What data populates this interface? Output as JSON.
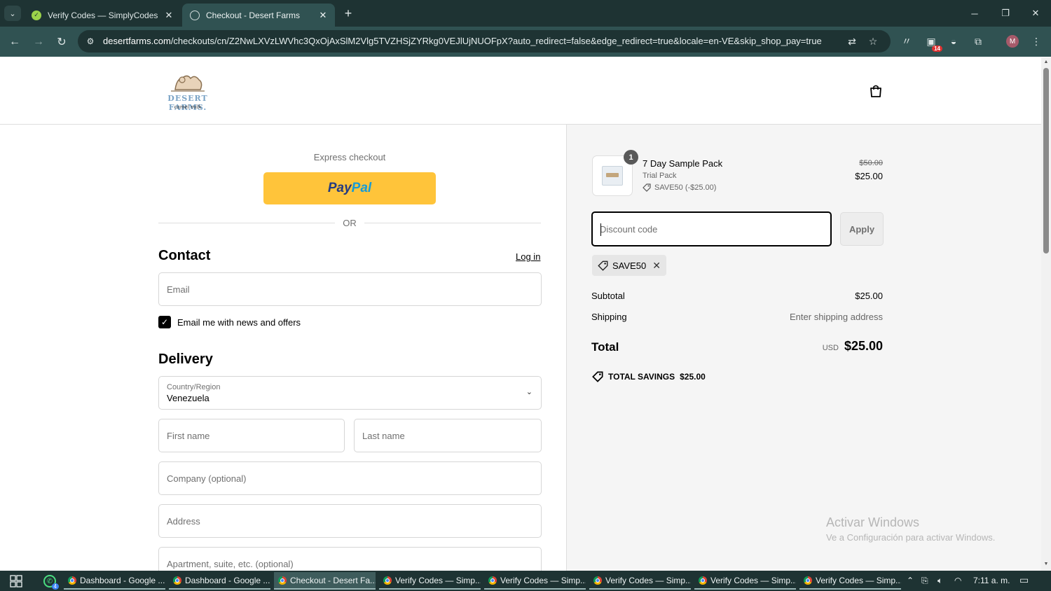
{
  "browser": {
    "tabs": [
      {
        "title": "Verify Codes — SimplyCodes",
        "active": false
      },
      {
        "title": "Checkout - Desert Farms",
        "active": true
      }
    ],
    "url_host": "desertfarms.com",
    "url_path": "/checkouts/cn/Z2NwLXVzLWVhc3QxOjAxSlM2Vlg5TVZHSjZYRkg0VEJlUjNUOFpX?auto_redirect=false&edge_redirect=true&locale=en-VE&skip_shop_pay=true",
    "extension_badge": "14",
    "profile_initial": "M",
    "icons": {
      "tab_search": "chevron-down-icon",
      "new_tab": "plus-icon",
      "back": "arrow-left-icon",
      "forward": "arrow-right-icon",
      "reload": "reload-icon",
      "site_info": "tune-icon",
      "translate": "translate-icon",
      "bookmark": "star-icon"
    }
  },
  "store": {
    "logo_text": "DESERT FARMS.",
    "logo_subtext": "camel milk"
  },
  "express": {
    "label": "Express checkout",
    "paypal_part1": "Pay",
    "paypal_part2": "Pal",
    "or_text": "OR"
  },
  "contact": {
    "title": "Contact",
    "login_link": "Log in",
    "email_placeholder": "Email",
    "newsletter_label": "Email me with news and offers",
    "newsletter_checked": true
  },
  "delivery": {
    "title": "Delivery",
    "country_label": "Country/Region",
    "country_value": "Venezuela",
    "first_name_placeholder": "First name",
    "last_name_placeholder": "Last name",
    "company_placeholder": "Company (optional)",
    "address_placeholder": "Address",
    "apartment_placeholder": "Apartment, suite, etc. (optional)"
  },
  "summary": {
    "product": {
      "quantity": "1",
      "name": "7 Day Sample Pack",
      "variant": "Trial Pack",
      "discount_line": "SAVE50 (-$25.00)",
      "original_price": "$50.00",
      "price": "$25.00"
    },
    "discount_placeholder": "Discount code",
    "apply_label": "Apply",
    "applied_code": "SAVE50",
    "subtotal_label": "Subtotal",
    "subtotal_value": "$25.00",
    "shipping_label": "Shipping",
    "shipping_value": "Enter shipping address",
    "total_label": "Total",
    "total_currency": "USD",
    "total_value": "$25.00",
    "savings_label": "TOTAL SAVINGS",
    "savings_value": "$25.00"
  },
  "watermark": {
    "title": "Activar Windows",
    "subtitle": "Ve a Configuración para activar Windows."
  },
  "taskbar": {
    "apps": [
      {
        "label": "Dashboard - Google ...",
        "active": false
      },
      {
        "label": "Dashboard - Google ...",
        "active": false
      },
      {
        "label": "Checkout - Desert Fa...",
        "active": true
      },
      {
        "label": "Verify Codes — Simp...",
        "active": false
      },
      {
        "label": "Verify Codes — Simp...",
        "active": false
      },
      {
        "label": "Verify Codes — Simp...",
        "active": false
      },
      {
        "label": "Verify Codes — Simp...",
        "active": false
      },
      {
        "label": "Verify Codes — Simp...",
        "active": false
      }
    ],
    "whatsapp_badge": "4",
    "clock": "7:11 a. m."
  }
}
